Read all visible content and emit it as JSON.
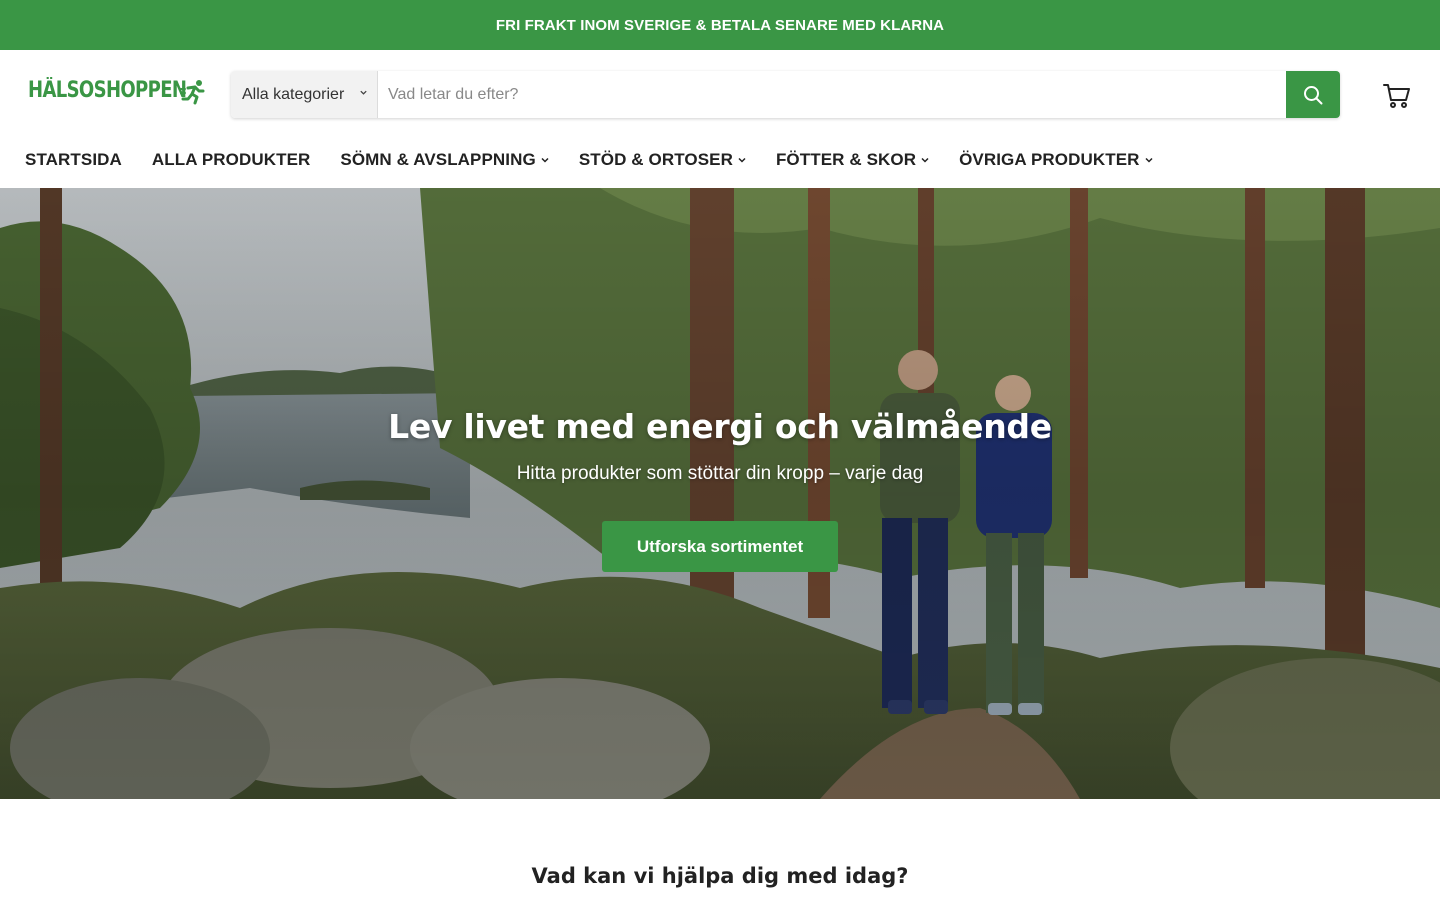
{
  "announcement": "FRI FRAKT INOM SVERIGE & BETALA SENARE MED KLARNA",
  "logo": {
    "text": "HÄLSOSHOPPEN",
    "icon": "runner-icon",
    "color": "#3a9645"
  },
  "search": {
    "category_label": "Alla kategorier",
    "placeholder": "Vad letar du efter?",
    "button_icon": "search-icon"
  },
  "cart": {
    "icon": "cart-icon"
  },
  "nav": [
    {
      "label": "STARTSIDA",
      "dropdown": false
    },
    {
      "label": "ALLA PRODUKTER",
      "dropdown": false
    },
    {
      "label": "SÖMN & AVSLAPPNING",
      "dropdown": true
    },
    {
      "label": "STÖD & ORTOSER",
      "dropdown": true
    },
    {
      "label": "FÖTTER & SKOR",
      "dropdown": true
    },
    {
      "label": "ÖVRIGA PRODUKTER",
      "dropdown": true
    }
  ],
  "hero": {
    "title": "Lev livet med energi och välmående",
    "subtitle": "Hitta produkter som stöttar din kropp – varje dag",
    "cta": "Utforska sortimentet"
  },
  "section": {
    "title": "Vad kan vi hjälpa dig med idag?"
  },
  "colors": {
    "brand_green": "#3a9645",
    "text": "#222222"
  }
}
